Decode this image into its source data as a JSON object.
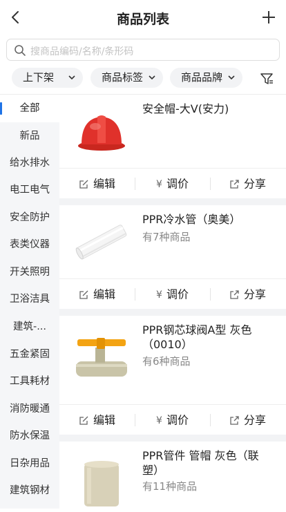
{
  "header": {
    "title": "商品列表"
  },
  "search": {
    "placeholder": "搜商品编码/名称/条形码"
  },
  "filters": [
    {
      "label": "上下架"
    },
    {
      "label": "商品标签"
    },
    {
      "label": "商品品牌"
    }
  ],
  "sidebar": {
    "items": [
      {
        "label": "全部",
        "active": true
      },
      {
        "label": "新品"
      },
      {
        "label": "给水排水"
      },
      {
        "label": "电工电气"
      },
      {
        "label": "安全防护"
      },
      {
        "label": "表类仪器"
      },
      {
        "label": "开关照明"
      },
      {
        "label": "卫浴洁具"
      },
      {
        "label": "建筑-..."
      },
      {
        "label": "五金紧固"
      },
      {
        "label": "工具耗材"
      },
      {
        "label": "消防暖通"
      },
      {
        "label": "防水保温"
      },
      {
        "label": "日杂用品"
      },
      {
        "label": "建筑钢材"
      }
    ]
  },
  "actions": {
    "edit": "编辑",
    "price": "调价",
    "share": "分享",
    "price_icon": "¥"
  },
  "products": [
    {
      "name": "安全帽-大V(安力)",
      "sub": "",
      "image": "red-safety-helmet"
    },
    {
      "name": "PPR冷水管（奥美）",
      "sub": "有7种商品",
      "image": "white-ppr-pipe"
    },
    {
      "name": "PPR钢芯球阀A型 灰色（0010）",
      "sub": "有6种商品",
      "image": "ppr-ball-valve"
    },
    {
      "name": "PPR管件 管帽 灰色（联塑）",
      "sub": "有11种商品",
      "image": "pipe-cap"
    }
  ],
  "colors": {
    "accent": "#1f73e6",
    "helmet": "#e0312b",
    "valve_handle": "#f3a313"
  }
}
